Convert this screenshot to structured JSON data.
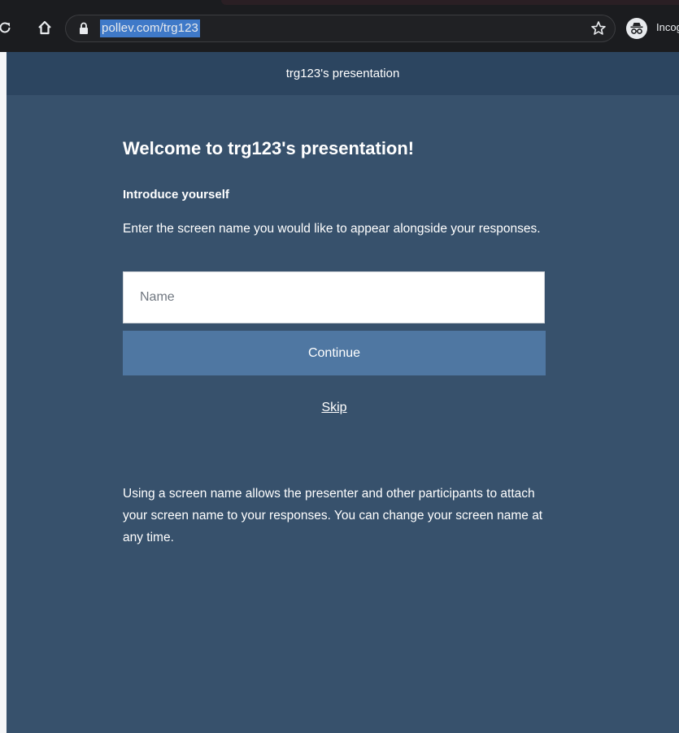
{
  "browser": {
    "url": "pollev.com/trg123",
    "profile_label": "Incognito",
    "icons": [
      "reload-icon",
      "home-icon",
      "lock-icon",
      "star-icon",
      "incognito-icon"
    ]
  },
  "header": {
    "title": "trg123's presentation"
  },
  "main": {
    "title": "Welcome to trg123's presentation!",
    "subtitle": "Introduce yourself",
    "instructions": "Enter the screen name you would like to appear alongside your responses.",
    "name_input": {
      "placeholder": "Name",
      "value": ""
    },
    "continue_label": "Continue",
    "skip_label": "Skip",
    "info": "Using a screen name allows the presenter and other participants to attach your screen name to your responses. You can change your screen name at any time."
  },
  "colors": {
    "page_background": "#37516c",
    "header_background": "#2c4560",
    "button_background": "#4f77a2",
    "url_highlight": "#3f79c8"
  }
}
